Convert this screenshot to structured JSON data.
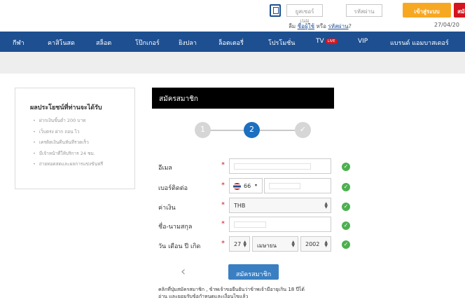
{
  "topbar": {
    "username_placeholder": "ยูสเซอร์เนม",
    "password_placeholder": "รหัสผ่าน",
    "login_label": "เข้าสู่ระบบ",
    "join_label": "สมัคร",
    "forgot_prefix": "ลืม",
    "forgot_user": "ชื่อผู้ใช้",
    "forgot_or": "หรือ",
    "forgot_pass": "รหัสผ่าน",
    "forgot_suffix": "?",
    "date": "27/04/20",
    "login_color": "#f7a823",
    "join_color": "#d4141e"
  },
  "nav": {
    "items": [
      "กีฬา",
      "คาสิโนสด",
      "สล็อต",
      "โป๊กเกอร์",
      "ยิงปลา",
      "ล็อตเตอรี่",
      "โปรโมชั่น",
      "TV",
      "VIP",
      "แบรนด์ แอมบาสเดอร์"
    ],
    "live_badge": "LIVE",
    "bg_color": "#1d4f91"
  },
  "benefits": {
    "title": "ผลประโยชน์ที่ท่านจะได้รับ",
    "items": [
      "ฝากเงินขั้นต่ำ 200 บาท",
      "เว็บตรง ฝาก ถอน ไว",
      "เครดิตเงินคืนทันทีรวดเร็ว",
      "มีเจ้าหน้าที่ให้บริการ 24 ชม.",
      "ถ่ายทอดสดและผลการแข่งขันฟรี"
    ]
  },
  "register": {
    "header": "สมัครสมาชิก",
    "steps": [
      "1",
      "2",
      "✓"
    ],
    "active_step": 2,
    "labels": {
      "email": "อีเมล",
      "phone": "เบอร์ติดต่อ",
      "currency": "ค่าเงิน",
      "fullname": "ชื่อ-นามสกุล",
      "dob": "วัน เดือน ปี เกิด"
    },
    "required_mark": "*",
    "phone_code": "66",
    "currency_value": "THB",
    "dob_day": "27",
    "dob_month": "เมษายน",
    "dob_year": "2002",
    "submit_label": "สมัครสมาชิก",
    "back_glyph": "‹",
    "terms_line1": "คลิกที่ปุ่มสมัครสมาชิก , ข้าพเจ้าขอยืนยันว่าข้าพเจ้ามีอายุเกิน 18 ปีได้",
    "terms_line2": "อ่าน และยอมรับข้อกำหนดและเงื่อนไขแล้ว",
    "ok_color": "#4cb050",
    "submit_color": "#3a7fc2"
  }
}
